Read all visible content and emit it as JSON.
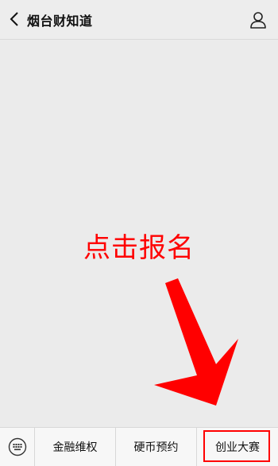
{
  "header": {
    "title": "烟台财知道",
    "back_icon": "chevron-left-icon",
    "profile_icon": "person-icon"
  },
  "annotation": {
    "text": "点击报名",
    "color": "#ff0000"
  },
  "bottom_menu": {
    "keyboard_icon": "keyboard-icon",
    "items": [
      {
        "label": "金融维权"
      },
      {
        "label": "硬币预约"
      },
      {
        "label": "创业大赛",
        "highlighted": true
      }
    ]
  },
  "colors": {
    "background": "#ebebeb",
    "highlight": "#ff0000"
  }
}
